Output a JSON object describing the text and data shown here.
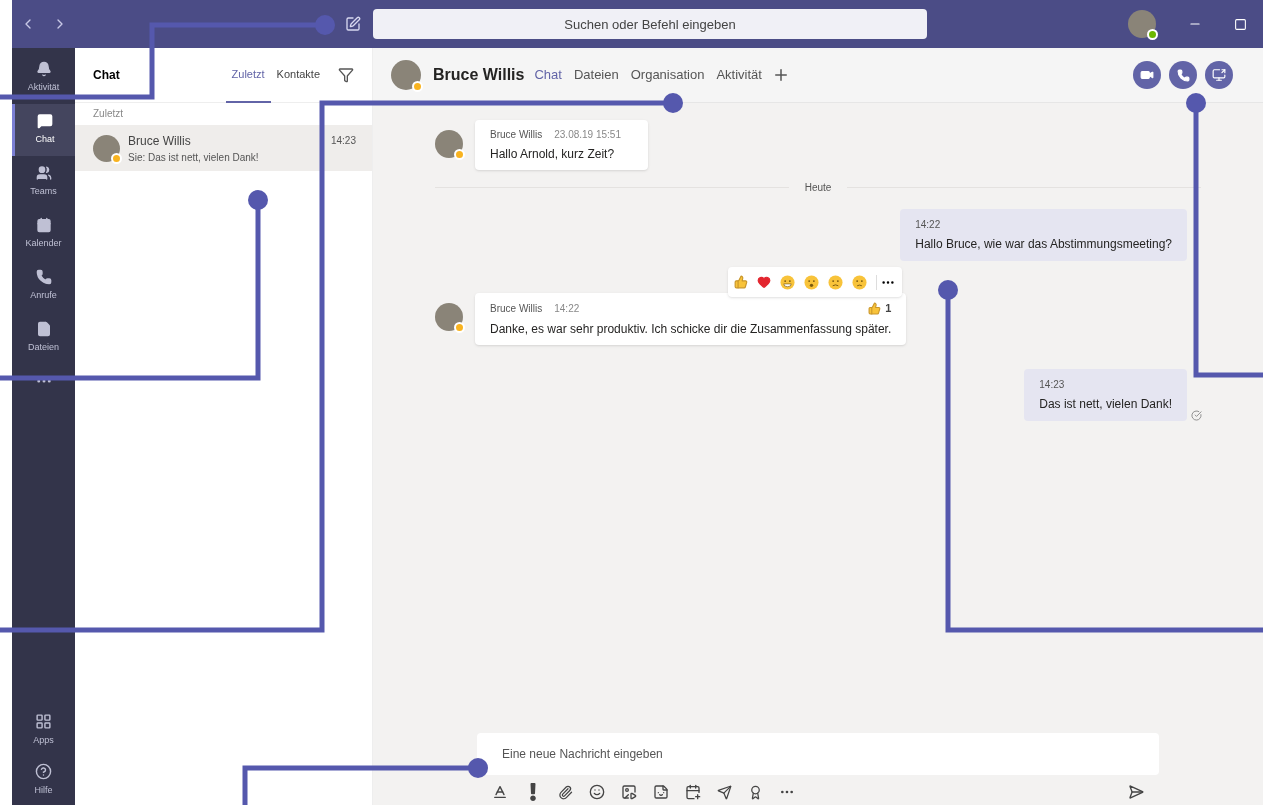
{
  "titlebar": {
    "search_placeholder": "Suchen oder Befehl eingeben"
  },
  "rail": {
    "items": [
      {
        "label": "Aktivität",
        "selected": false
      },
      {
        "label": "Chat",
        "selected": true
      },
      {
        "label": "Teams",
        "selected": false
      },
      {
        "label": "Kalender",
        "selected": false
      },
      {
        "label": "Anrufe",
        "selected": false
      },
      {
        "label": "Dateien",
        "selected": false
      }
    ],
    "bottom_items": [
      {
        "label": "Apps"
      },
      {
        "label": "Hilfe"
      }
    ]
  },
  "chat_list": {
    "title": "Chat",
    "tabs": [
      {
        "label": "Zuletzt",
        "selected": true
      },
      {
        "label": "Kontakte",
        "selected": false
      }
    ],
    "section": "Zuletzt",
    "items": [
      {
        "name": "Bruce Willis",
        "preview": "Sie: Das ist nett, vielen Dank!",
        "time": "14:23",
        "selected": true
      }
    ]
  },
  "conversation": {
    "name": "Bruce Willis",
    "tabs": [
      {
        "label": "Chat",
        "selected": true
      },
      {
        "label": "Dateien",
        "selected": false
      },
      {
        "label": "Organisation",
        "selected": false
      },
      {
        "label": "Aktivität",
        "selected": false
      }
    ],
    "messages": [
      {
        "kind": "received",
        "author": "Bruce Willis",
        "time": "23.08.19 15:51",
        "text": "Hallo Arnold, kurz Zeit?"
      },
      {
        "kind": "divider",
        "text": "Heute"
      },
      {
        "kind": "sent",
        "time": "14:22",
        "text": "Hallo Bruce, wie war das Abstimmungsmeeting?",
        "read": false
      },
      {
        "kind": "received",
        "author": "Bruce Willis",
        "time": "14:22",
        "text": "Danke, es war sehr produktiv. Ich schicke dir die Zusammenfassung später.",
        "reaction_count": "1",
        "reaction_bar": true
      },
      {
        "kind": "sent",
        "time": "14:23",
        "text": "Das ist nett, vielen Dank!",
        "read": true
      }
    ],
    "composer": {
      "placeholder": "Eine neue Nachricht eingeben"
    }
  }
}
